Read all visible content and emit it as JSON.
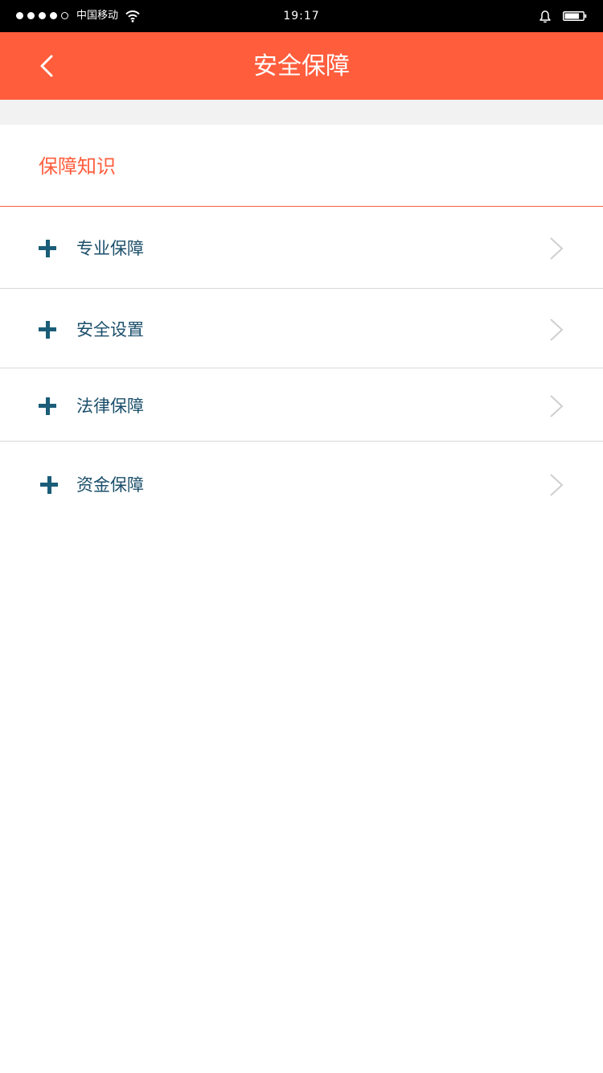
{
  "status_bar": {
    "carrier": "中国移动",
    "time": "19:17",
    "signal_strength": 4,
    "signal_max": 5,
    "battery_level": 0.8
  },
  "nav": {
    "title": "安全保障"
  },
  "section": {
    "title": "保障知识"
  },
  "menu": {
    "items": [
      {
        "label": "专业保障"
      },
      {
        "label": "安全设置"
      },
      {
        "label": "法律保障"
      },
      {
        "label": "资金保障"
      }
    ]
  },
  "colors": {
    "accent": "#ff5d3c",
    "item_text": "#1b4f6b",
    "plus": "#1b5d78",
    "divider": "#d9d9d9",
    "background_band": "#f2f2f2"
  }
}
